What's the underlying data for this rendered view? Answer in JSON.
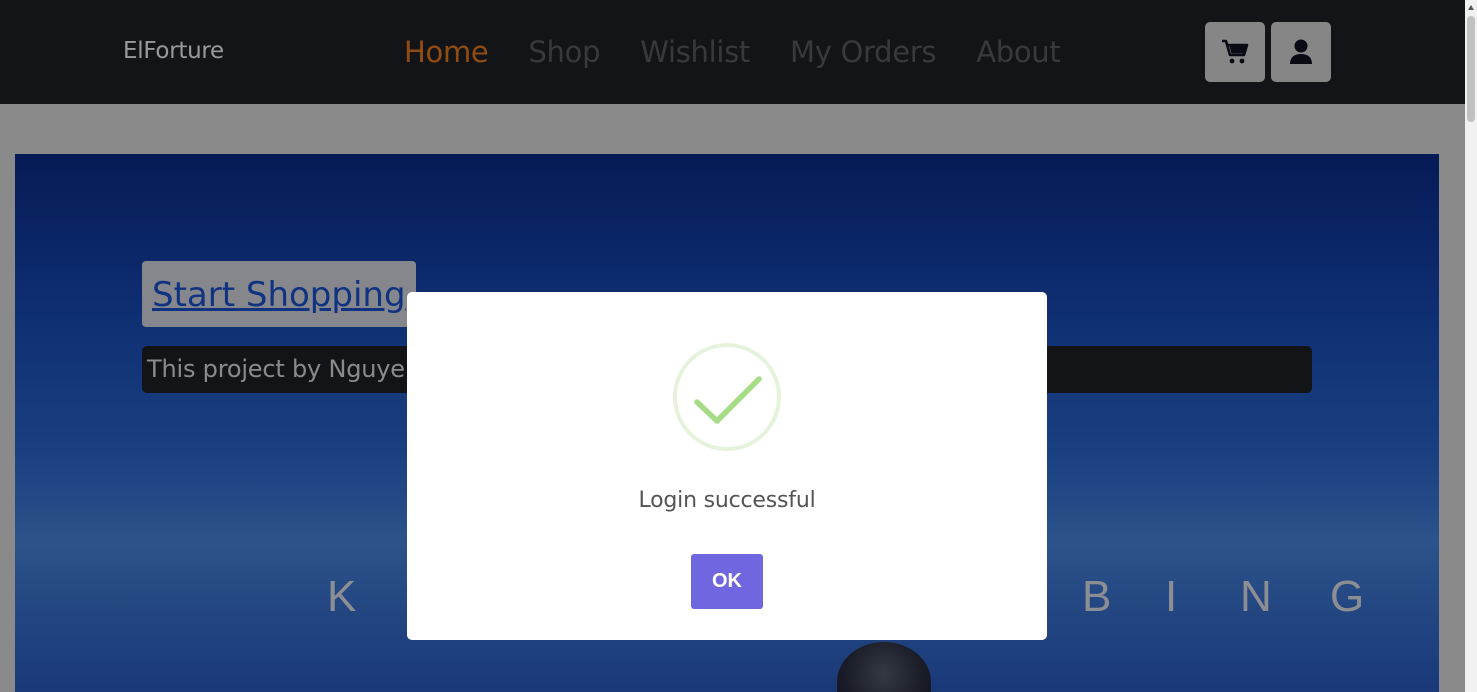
{
  "navbar": {
    "brand": "ElForture",
    "links": [
      "Home",
      "Shop",
      "Wishlist",
      "My Orders",
      "About"
    ],
    "active_index": 0,
    "cart_icon": "cart-icon",
    "user_icon": "user-icon"
  },
  "hero": {
    "cta_label": "Start Shopping",
    "intro_text": "This project by Nguyen T",
    "banner_letters": [
      "K",
      "B",
      "I",
      "N",
      "G"
    ]
  },
  "modal": {
    "icon": "success-check-icon",
    "title": "Login successful",
    "confirm_label": "OK"
  },
  "colors": {
    "navbar_bg": "#212228",
    "nav_active": "#f07f1e",
    "nav_inactive": "#5f5f63",
    "confirm_button": "#7066e0",
    "success_check": "#a5dc86"
  }
}
